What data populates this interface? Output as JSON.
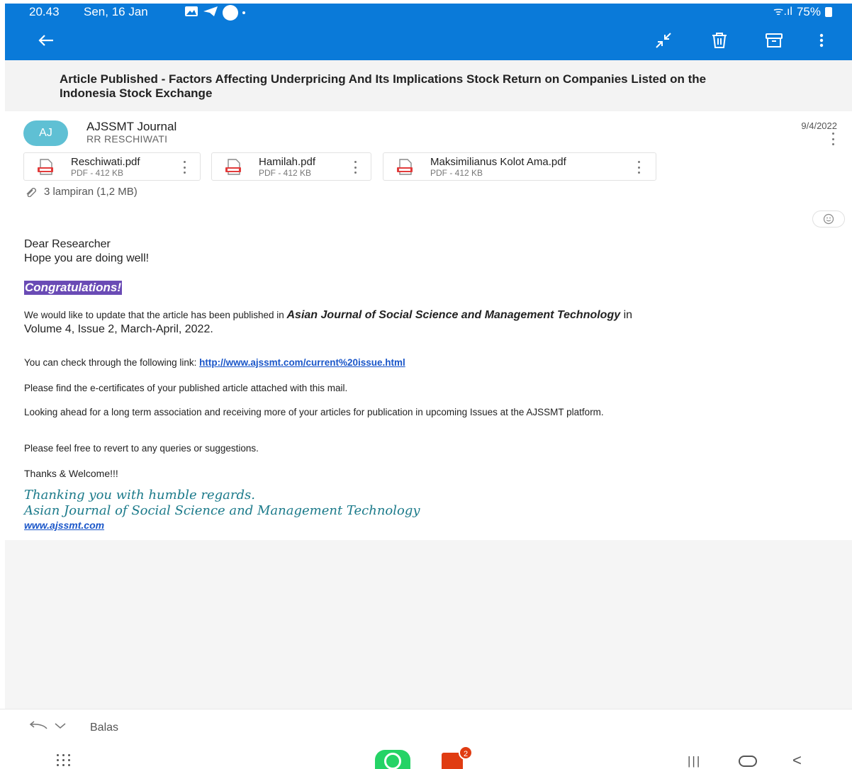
{
  "status_bar": {
    "time": "20.43",
    "date": "Sen, 16 Jan",
    "signal": "ᯤ.ıl",
    "battery": "75%"
  },
  "toolbar": {
    "back_icon": "arrow-left-icon",
    "actions": [
      "collapse-icon",
      "trash-icon",
      "archive-icon",
      "more-vertical-icon"
    ]
  },
  "email": {
    "subject": "Article Published - Factors Affecting Underpricing And Its Implications Stock Return on Companies Listed on the Indonesia Stock Exchange",
    "sender": {
      "initials": "AJ",
      "name": "AJSSMT Journal",
      "to": "RR RESCHIWATI"
    },
    "date": "9/4/2022",
    "attachments": [
      {
        "name": "Reschiwati.pdf",
        "meta": "PDF - 412 KB"
      },
      {
        "name": "Hamilah.pdf",
        "meta": "PDF - 412 KB"
      },
      {
        "name": "Maksimilianus Kolot Ama.pdf",
        "meta": "PDF - 412 KB"
      }
    ],
    "attachment_summary": "3 lampiran (1,2 MB)",
    "body": {
      "greeting": "Dear Researcher",
      "greeting2": "Hope you are doing well!",
      "congrats": "Congratulations!",
      "p1_start": "We would like to update that the article has been published in ",
      "p1_journal": "Asian Journal of Social Science and Management Technology",
      "p1_in": " in",
      "p1_volume": "Volume 4, Issue 2, March-April, 2022.",
      "p2_text": "You can check through the following link: ",
      "p2_link": "http://www.ajssmt.com/current%20issue.html",
      "p3": "Please find the e-certificates of your published article attached with this mail.",
      "p4": "Looking ahead for a long term association and receiving more of your articles for publication in upcoming Issues at the AJSSMT platform.",
      "p5": "Please feel free to revert to any queries or suggestions.",
      "p6": "Thanks & Welcome!!!",
      "sig1": "Thanking you with humble regards.",
      "sig2": "Asian Journal of Social Science and Management Technology",
      "sig3": "www.ajssmt.com"
    }
  },
  "reply_bar": {
    "label": "Balas"
  },
  "nav_bar": {
    "office_badge": "2"
  },
  "colors": {
    "app_bar": "#0a7ad9",
    "avatar": "#5fc0d4",
    "highlight": "#6a4bb5",
    "signature": "#1b7a8a",
    "link": "#1a56c9"
  }
}
